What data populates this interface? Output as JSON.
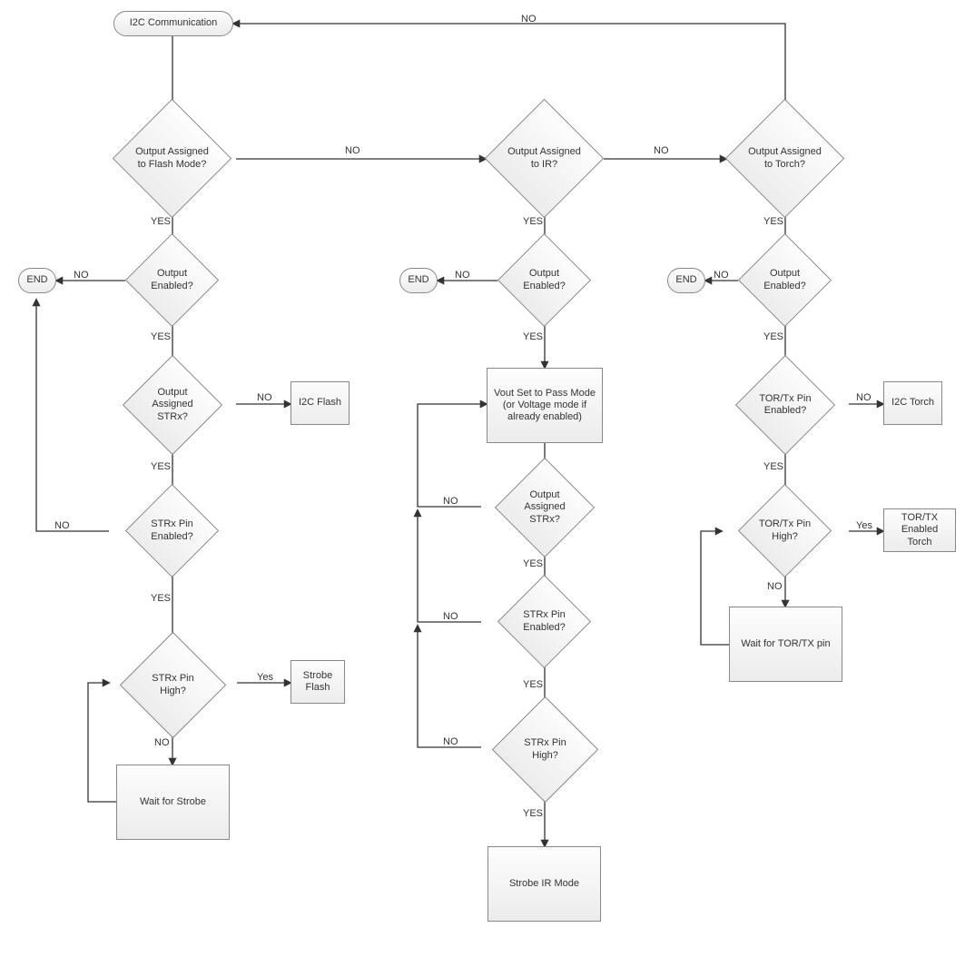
{
  "nodes": {
    "start": "I2C Communication",
    "q_flash": "Output Assigned to Flash Mode?",
    "q_ir": "Output Assigned to IR?",
    "q_torch": "Output Assigned to Torch?",
    "q_en1": "Output Enabled?",
    "q_en2": "Output Enabled?",
    "q_en3": "Output Enabled?",
    "end1": "END",
    "end2": "END",
    "end3": "END",
    "q_strx1": "Output Assigned STRx?",
    "i2c_flash": "I2C Flash",
    "vout": "Vout Set to Pass Mode (or Voltage mode if already enabled)",
    "q_strx2": "Output Assigned STRx?",
    "q_pin1": "STRx Pin Enabled?",
    "q_pin2": "STRx Pin Enabled?",
    "q_high1": "STRx Pin High?",
    "q_high2": "STRx Pin High?",
    "strobe_flash": "Strobe Flash",
    "wait_strobe": "Wait for Strobe",
    "strobe_ir": "Strobe IR Mode",
    "q_tor_en": "TOR/Tx Pin Enabled?",
    "i2c_torch": "I2C Torch",
    "q_tor_high": "TOR/Tx Pin High?",
    "tor_enabled": "TOR/TX Enabled Torch",
    "wait_tor": "Wait for TOR/TX pin"
  },
  "labels": {
    "yes": "YES",
    "yes_sm": "Yes",
    "no": "NO"
  }
}
